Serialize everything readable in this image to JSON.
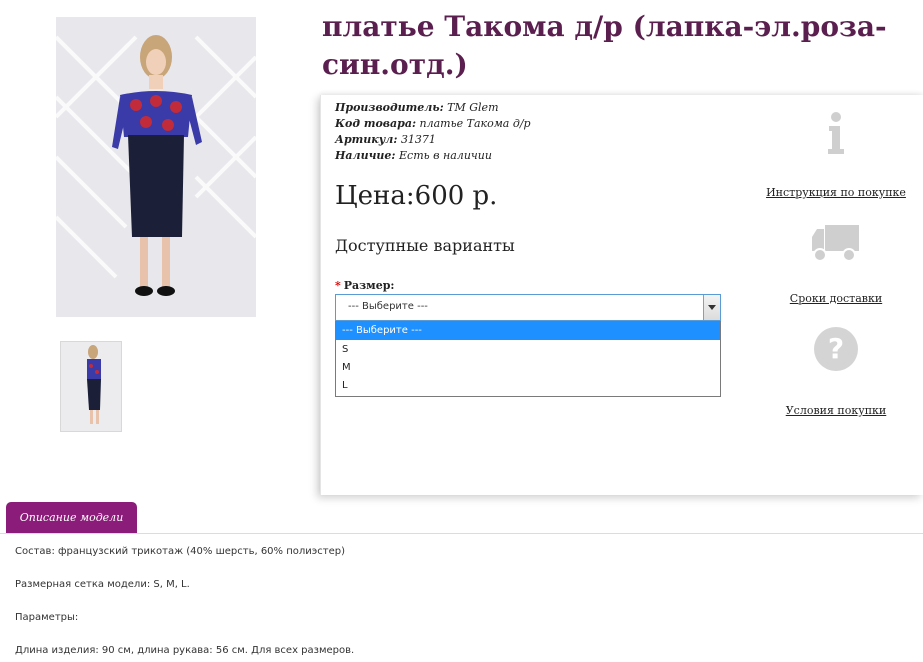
{
  "product": {
    "title": "платье Такома д/р (лапка-эл.роза-син.отд.)",
    "manufacturer_label": "Производитель:",
    "manufacturer_value": "ТМ Glem",
    "code_label": "Код товара:",
    "code_value": "платье Такома д/р",
    "sku_label": "Артикул:",
    "sku_value": "31371",
    "availability_label": "Наличие:",
    "availability_value": "Есть в наличии",
    "price": "Цена:600 р.",
    "variants_heading": "Доступные варианты"
  },
  "size": {
    "required_mark": "*",
    "label": "Размер:",
    "selected": "--- Выберите ---",
    "options": [
      "--- Выберите ---",
      "S",
      "M",
      "L"
    ]
  },
  "side": {
    "instruction": "Инструкция по покупке",
    "delivery": "Сроки доставки",
    "terms": "Условия покупки",
    "icons": [
      "info-icon",
      "truck-icon",
      "question-icon"
    ]
  },
  "tab": {
    "label": "Описание модели"
  },
  "description": {
    "composition": "Состав: французский трикотаж (40% шерсть, 60% полиэстер)",
    "sizes": "Размерная сетка модели: S, M, L.",
    "params": "Параметры:",
    "length": "Длина изделия: 90 см, длина рукава: 56 см. Для всех размеров."
  },
  "colors": {
    "title": "#5a1f4e",
    "tab": "#8b1c7a",
    "dropdown_highlight": "#1e90ff",
    "icon_gray": "#cfcfcf"
  }
}
